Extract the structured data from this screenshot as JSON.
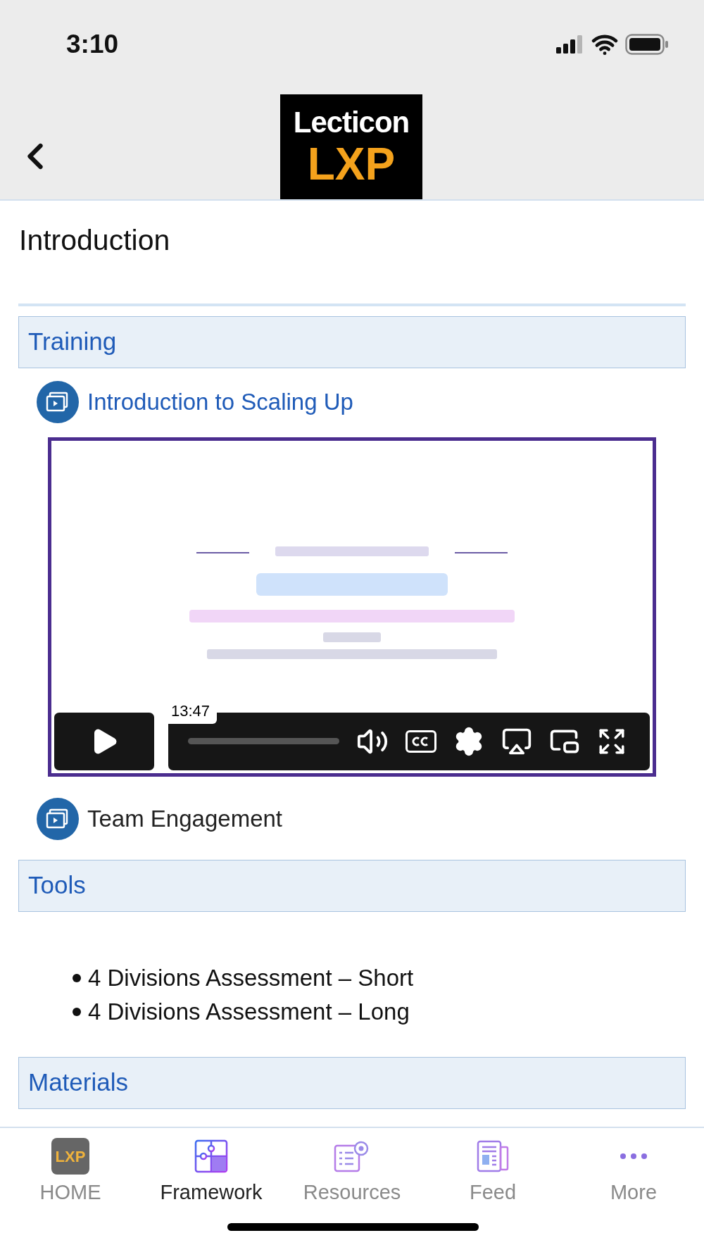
{
  "status_bar": {
    "time": "3:10"
  },
  "header": {
    "logo": {
      "top": "Lecticon",
      "bottom": "LXP"
    }
  },
  "page_title": "Introduction",
  "sections": [
    {
      "title": "Training",
      "kind": "activities",
      "items": [
        {
          "label": "Introduction to Scaling Up",
          "linked": true,
          "video": {
            "time": "13:47"
          }
        },
        {
          "label": "Team Engagement",
          "linked": false
        }
      ]
    },
    {
      "title": "Tools",
      "kind": "bullets",
      "items": [
        {
          "label": "4 Divisions Assessment – Short"
        },
        {
          "label": "4 Divisions Assessment – Long"
        }
      ]
    },
    {
      "title": "Materials",
      "kind": "activities"
    }
  ],
  "tab_bar": [
    {
      "label": "HOME",
      "kind": "home",
      "icon_text": "LXP",
      "selected": false
    },
    {
      "label": "Framework",
      "kind": "puzzle",
      "selected": true
    },
    {
      "label": "Resources",
      "kind": "resources",
      "selected": false
    },
    {
      "label": "Feed",
      "kind": "feed",
      "selected": false
    },
    {
      "label": "More",
      "kind": "more",
      "selected": false
    }
  ]
}
